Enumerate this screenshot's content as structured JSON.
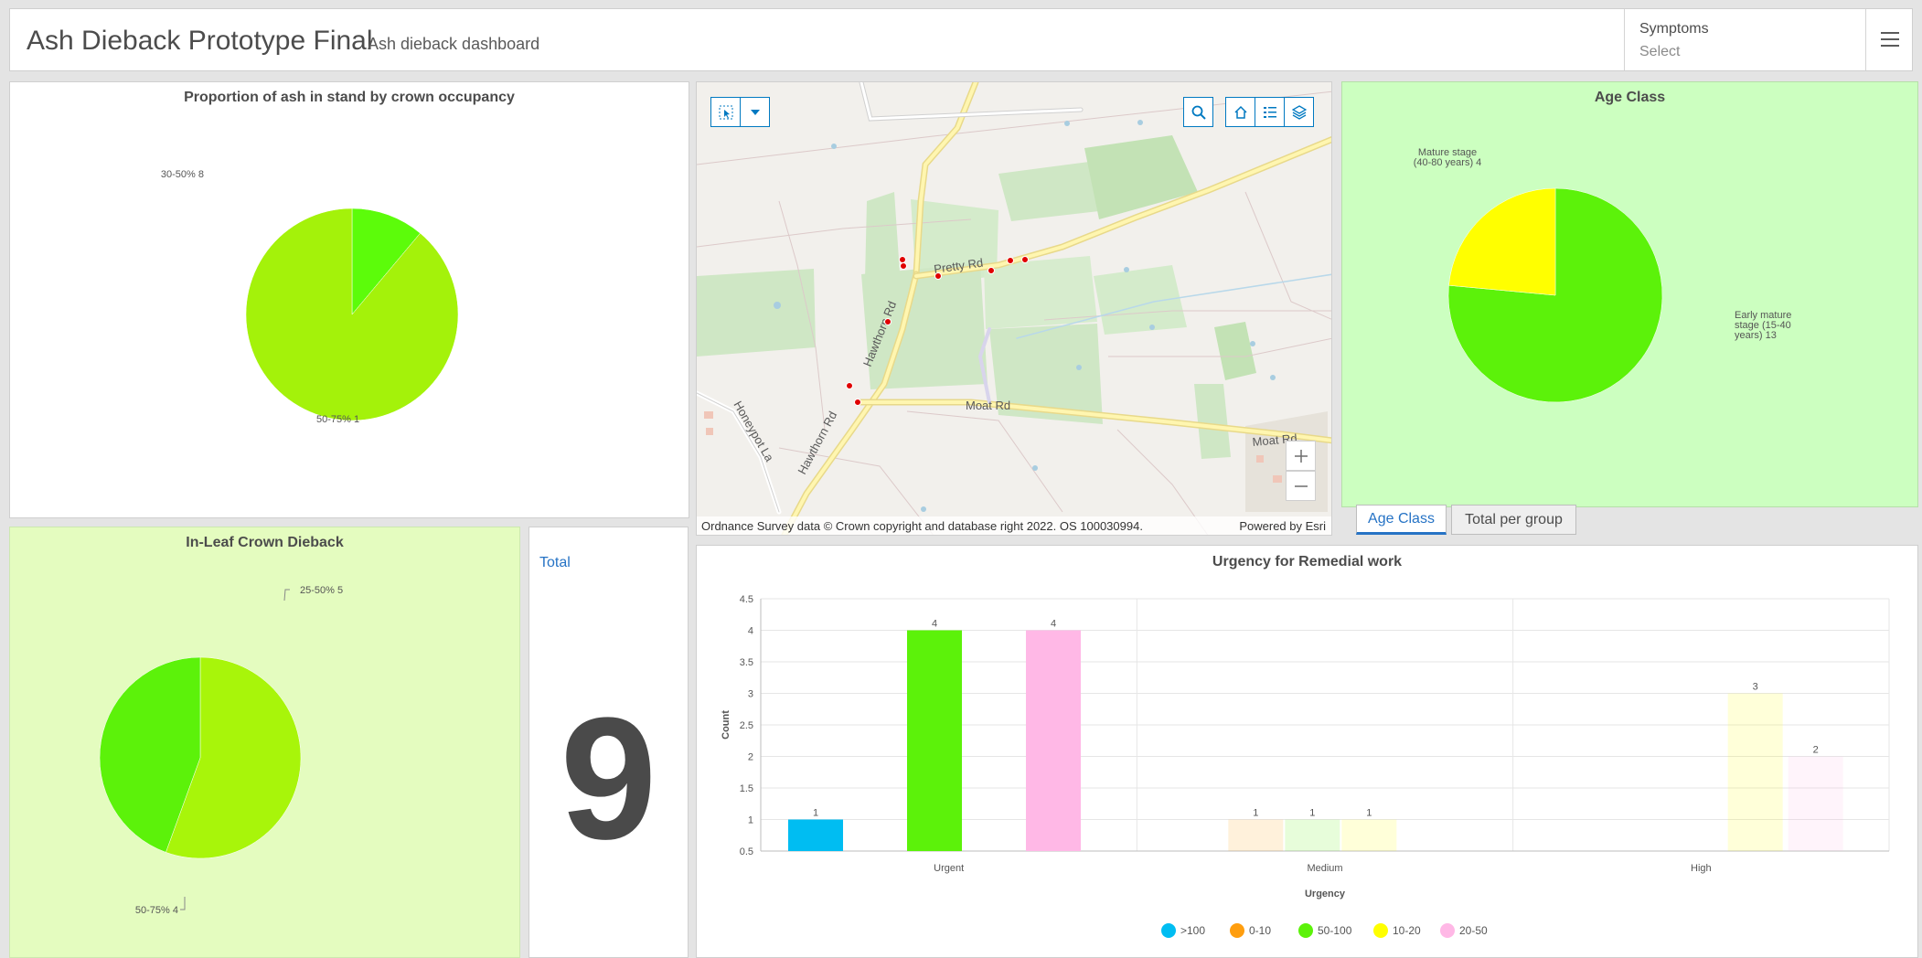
{
  "header": {
    "title": "Ash Dieback Prototype Final",
    "subtitle": "Ash dieback dashboard",
    "selector_label": "Symptoms",
    "selector_value": "Select",
    "menu_icon": "hamburger-menu-icon"
  },
  "crown_occupancy": {
    "chart_data": {
      "type": "pie",
      "title": "Proportion of ash in stand by crown occupancy",
      "slices": [
        {
          "label": "30-50% 8",
          "value": 8,
          "color": "#a4f20a"
        },
        {
          "label": "50-75% 1",
          "value": 1,
          "color": "#5cfc0a"
        }
      ]
    }
  },
  "map": {
    "roads": [
      "Pretty Rd",
      "Hawthorn Rd",
      "Moat Rd",
      "Honeypot La",
      "Hawthorn Rd",
      "Moat Rd"
    ],
    "attribution": "Ordnance Survey data © Crown copyright and database right 2022. OS 100030994.",
    "powered_by": "Powered by Esri",
    "tools": [
      "select-tool-icon",
      "dropdown-icon",
      "search-icon",
      "home-icon",
      "legend-icon",
      "layers-icon",
      "zoom-in-icon",
      "zoom-out-icon"
    ]
  },
  "age_class": {
    "chart_data": {
      "type": "pie",
      "title": "Age Class",
      "slices": [
        {
          "label_lines": [
            "Early mature",
            "stage (15-40",
            "years) 13"
          ],
          "value": 13,
          "color": "#5cf20a"
        },
        {
          "label_lines": [
            "Mature stage",
            "(40-80 years) 4"
          ],
          "value": 4,
          "color": "#ffff00"
        }
      ]
    }
  },
  "tabs": [
    {
      "label": "Age Class",
      "active": true
    },
    {
      "label": "Total per group",
      "active": false
    }
  ],
  "in_leaf": {
    "chart_data": {
      "type": "pie",
      "title": "In-Leaf  Crown Dieback",
      "slices": [
        {
          "label": "25-50% 5",
          "value": 5,
          "color": "#a8f50a"
        },
        {
          "label": "50-75% 4",
          "value": 4,
          "color": "#5cf20a"
        }
      ]
    }
  },
  "total": {
    "label": "Total",
    "value": "9"
  },
  "urgency": {
    "chart_data": {
      "type": "bar",
      "title": "Urgency for Remedial work",
      "xlabel": "Urgency",
      "ylabel": "Count",
      "categories": [
        "Urgent",
        "Medium",
        "High"
      ],
      "ylim": [
        0.5,
        4.5
      ],
      "yticks": [
        "4.5",
        "4",
        "3.5",
        "3",
        "2.5",
        "2",
        "1.5",
        "1",
        "0.5"
      ],
      "series": [
        {
          "name": ">100",
          "color": "#00bdf2",
          "values": [
            1,
            null,
            null
          ]
        },
        {
          "name": "0-10",
          "color": "#ff9e0f",
          "values": [
            null,
            1,
            null
          ]
        },
        {
          "name": "50-100",
          "color": "#5cf20a",
          "values": [
            4,
            1,
            null
          ]
        },
        {
          "name": "10-20",
          "color": "#ffff00",
          "values": [
            null,
            1,
            3
          ]
        },
        {
          "name": "20-50",
          "color": "#ffb8e6",
          "values": [
            4,
            null,
            2
          ]
        }
      ],
      "bars": [
        {
          "cat": 0,
          "slot": 0,
          "series": 0,
          "value": 1,
          "faded": false
        },
        {
          "cat": 0,
          "slot": 1,
          "series": 2,
          "value": 4,
          "faded": false
        },
        {
          "cat": 0,
          "slot": 2,
          "series": 4,
          "value": 4,
          "faded": false
        },
        {
          "cat": 1,
          "slot": 0,
          "series": 1,
          "value": 1,
          "faded": true
        },
        {
          "cat": 1,
          "slot": 1,
          "series": 2,
          "value": 1,
          "faded": true
        },
        {
          "cat": 1,
          "slot": 2,
          "series": 3,
          "value": 1,
          "faded": true
        },
        {
          "cat": 2,
          "slot": 0,
          "series": 3,
          "value": 3,
          "faded": true
        },
        {
          "cat": 2,
          "slot": 1,
          "series": 4,
          "value": 2,
          "faded": true
        }
      ],
      "legend_position": "bottom"
    }
  }
}
